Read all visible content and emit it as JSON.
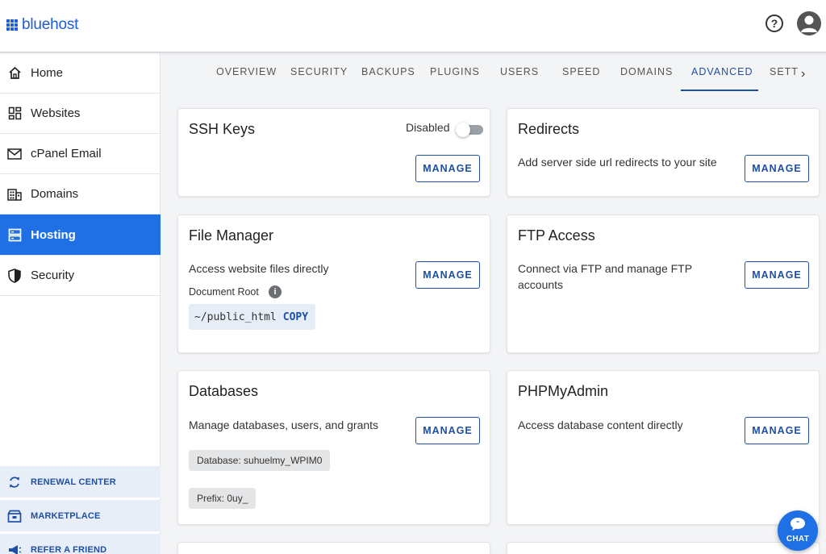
{
  "header": {
    "logo_text": "bluehost",
    "help_glyph": "?",
    "brand_color": "#1f5cd6"
  },
  "sidebar": {
    "items": [
      {
        "label": "Home",
        "icon": "home-icon"
      },
      {
        "label": "Websites",
        "icon": "websites-grid-icon"
      },
      {
        "label": "cPanel Email",
        "icon": "mail-icon"
      },
      {
        "label": "Domains",
        "icon": "domains-building-icon"
      },
      {
        "label": "Hosting",
        "icon": "hosting-server-icon",
        "active": true
      },
      {
        "label": "Security",
        "icon": "shield-icon"
      }
    ],
    "bottom_items": [
      {
        "label": "RENEWAL CENTER",
        "icon": "refresh-icon"
      },
      {
        "label": "MARKETPLACE",
        "icon": "marketplace-icon"
      },
      {
        "label": "REFER A FRIEND",
        "icon": "megaphone-icon"
      }
    ],
    "active_color": "#1f6fe5"
  },
  "tabs": {
    "items": [
      "OVERVIEW",
      "SECURITY",
      "BACKUPS",
      "PLUGINS",
      "USERS",
      "SPEED",
      "DOMAINS",
      "ADVANCED",
      "SETT"
    ],
    "active": "ADVANCED",
    "next_arrow": "›"
  },
  "cards": {
    "ssh": {
      "title": "SSH Keys",
      "toggle_label": "Disabled",
      "toggle_on": false,
      "button": "MANAGE"
    },
    "redirects": {
      "title": "Redirects",
      "desc": "Add server side url redirects to your site",
      "button": "MANAGE"
    },
    "file_manager": {
      "title": "File Manager",
      "desc": "Access website files directly",
      "doc_root_label": "Document Root",
      "info_glyph": "i",
      "path": "~/public_html",
      "copy": "COPY",
      "button": "MANAGE"
    },
    "ftp": {
      "title": "FTP Access",
      "desc_line1": "Connect via FTP and manage FTP",
      "desc_line2": "accounts",
      "button": "MANAGE"
    },
    "databases": {
      "title": "Databases",
      "desc": "Manage databases, users, and grants",
      "database_chip": "Database: suhuelmy_WPIM0",
      "prefix_chip": "Prefix: 0uy_",
      "button": "MANAGE"
    },
    "phpmyadmin": {
      "title": "PHPMyAdmin",
      "desc": "Access database content directly",
      "button": "MANAGE"
    }
  },
  "chat": {
    "label": "CHAT"
  }
}
